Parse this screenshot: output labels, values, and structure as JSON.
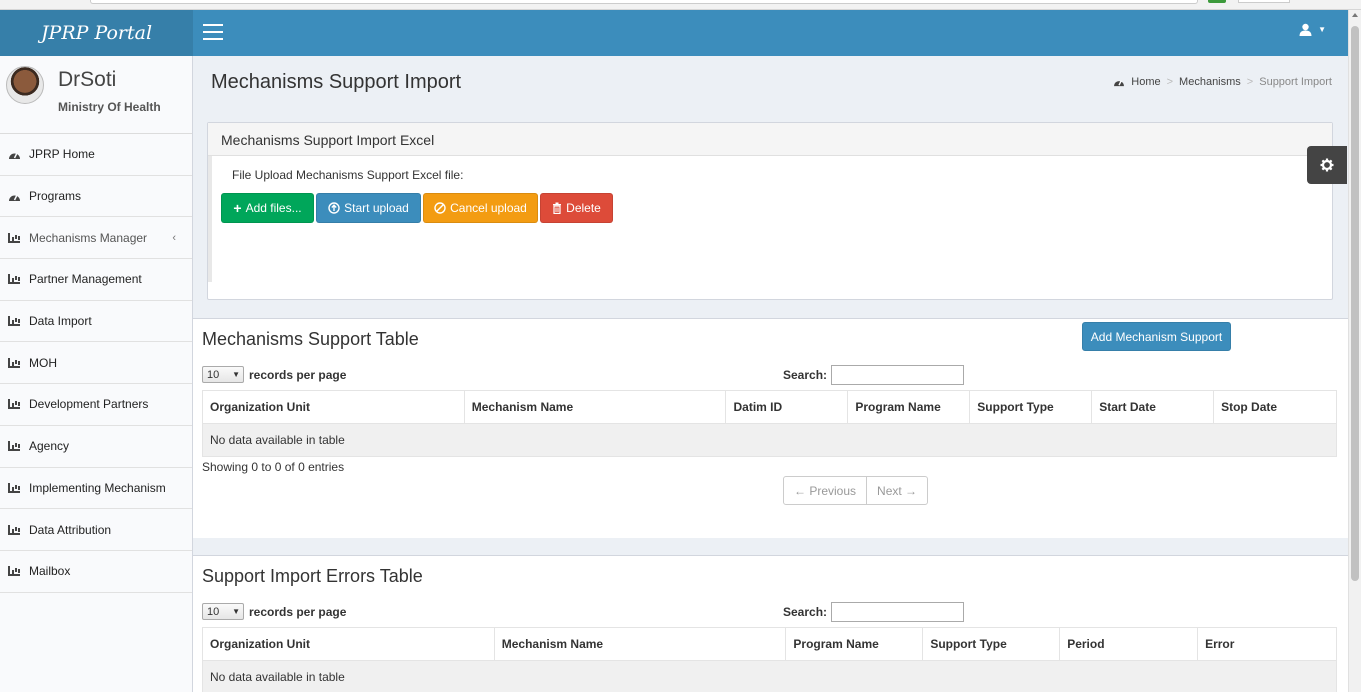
{
  "app": {
    "brand": "JPRP Portal"
  },
  "user": {
    "name": "DrSoti",
    "org": "Ministry Of Health"
  },
  "sidebar": {
    "items": [
      {
        "label": "JPRP Home",
        "icon": "dashboard-icon"
      },
      {
        "label": "Programs",
        "icon": "dashboard-icon"
      },
      {
        "label": "Mechanisms Manager",
        "icon": "bar-chart-icon",
        "chevron": "‹"
      },
      {
        "label": "Partner Management",
        "icon": "bar-chart-icon"
      },
      {
        "label": "Data Import",
        "icon": "bar-chart-icon"
      },
      {
        "label": "MOH",
        "icon": "bar-chart-icon"
      },
      {
        "label": "Development Partners",
        "icon": "bar-chart-icon"
      },
      {
        "label": "Agency",
        "icon": "bar-chart-icon"
      },
      {
        "label": "Implementing Mechanism",
        "icon": "bar-chart-icon"
      },
      {
        "label": "Data Attribution",
        "icon": "bar-chart-icon"
      },
      {
        "label": "Mailbox",
        "icon": "bar-chart-icon"
      }
    ]
  },
  "page": {
    "title": "Mechanisms Support Import",
    "breadcrumb": {
      "home": "Home",
      "mid": "Mechanisms",
      "current": "Support Import",
      "sep": ">"
    }
  },
  "upload": {
    "box_title": "Mechanisms Support Import Excel",
    "label": "File Upload Mechanisms Support Excel file:",
    "add_files": "Add files...",
    "start_upload": "Start upload",
    "cancel_upload": "Cancel upload",
    "delete": "Delete"
  },
  "support_table": {
    "title": "Mechanisms Support Table",
    "add_button": "Add Mechanism Support",
    "page_size": "10",
    "rpp_label": "records per page",
    "search_label": "Search:",
    "columns": [
      "Organization Unit",
      "Mechanism Name",
      "Datim ID",
      "Program Name",
      "Support Type",
      "Start Date",
      "Stop Date"
    ],
    "empty": "No data available in table",
    "info": "Showing 0 to 0 of 0 entries",
    "prev": "← Previous",
    "next": "Next →"
  },
  "errors_table": {
    "title": "Support Import Errors Table",
    "page_size": "10",
    "rpp_label": "records per page",
    "search_label": "Search:",
    "columns": [
      "Organization Unit",
      "Mechanism Name",
      "Program Name",
      "Support Type",
      "Period",
      "Error"
    ],
    "empty": "No data available in table"
  },
  "colors": {
    "header": "#3c8dbc",
    "logo": "#367fa9",
    "success": "#00a65a",
    "warning": "#f39c12",
    "danger": "#dd4b39"
  }
}
